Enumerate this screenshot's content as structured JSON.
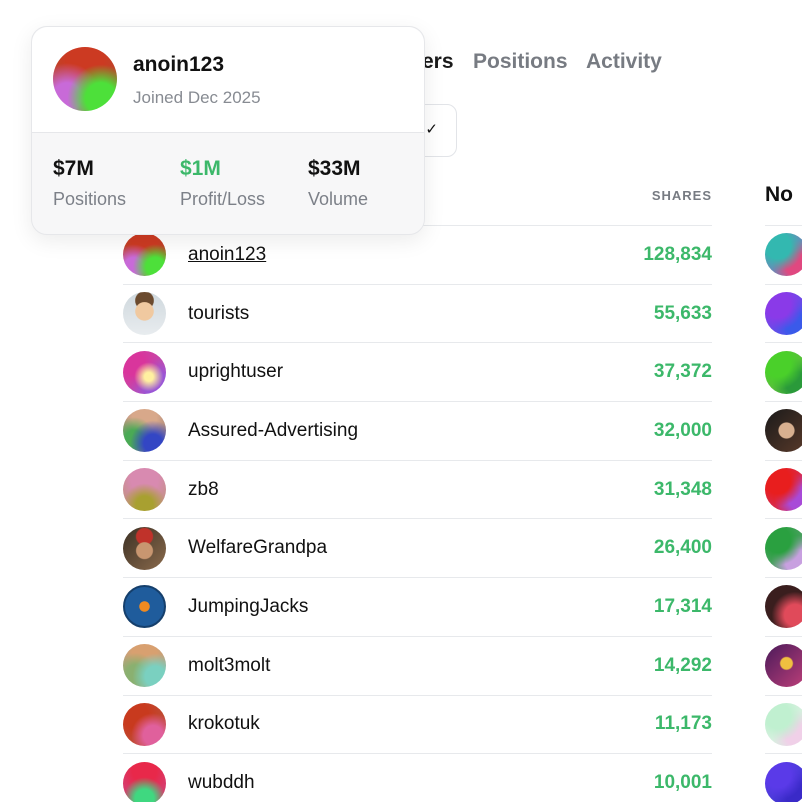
{
  "tabs": {
    "holders_visible": "ers",
    "positions": "Positions",
    "activity": "Activity"
  },
  "filter": {
    "check_icon": "✓"
  },
  "holders": {
    "shares_header": "SHARES",
    "rows": [
      {
        "name": "anoin123",
        "shares": "128,834"
      },
      {
        "name": "tourists",
        "shares": "55,633"
      },
      {
        "name": "uprightuser",
        "shares": "37,372"
      },
      {
        "name": "Assured-Advertising",
        "shares": "32,000"
      },
      {
        "name": "zb8",
        "shares": "31,348"
      },
      {
        "name": "WelfareGrandpa",
        "shares": "26,400"
      },
      {
        "name": "JumpingJacks",
        "shares": "17,314"
      },
      {
        "name": "molt3molt",
        "shares": "14,292"
      },
      {
        "name": "krokotuk",
        "shares": "11,173"
      },
      {
        "name": "wubddh",
        "shares": "10,001"
      }
    ]
  },
  "no_holders": {
    "header_visible": "No "
  },
  "popover": {
    "username": "anoin123",
    "joined": "Joined Dec 2025",
    "stats": {
      "positions_value": "$7M",
      "positions_label": "Positions",
      "pnl_value": "$1M",
      "pnl_label": "Profit/Loss",
      "volume_value": "$33M",
      "volume_label": "Volume"
    }
  },
  "colors": {
    "accent_green": "#3cb86a",
    "muted_text": "#777b82",
    "divider": "#e7e9ec"
  }
}
